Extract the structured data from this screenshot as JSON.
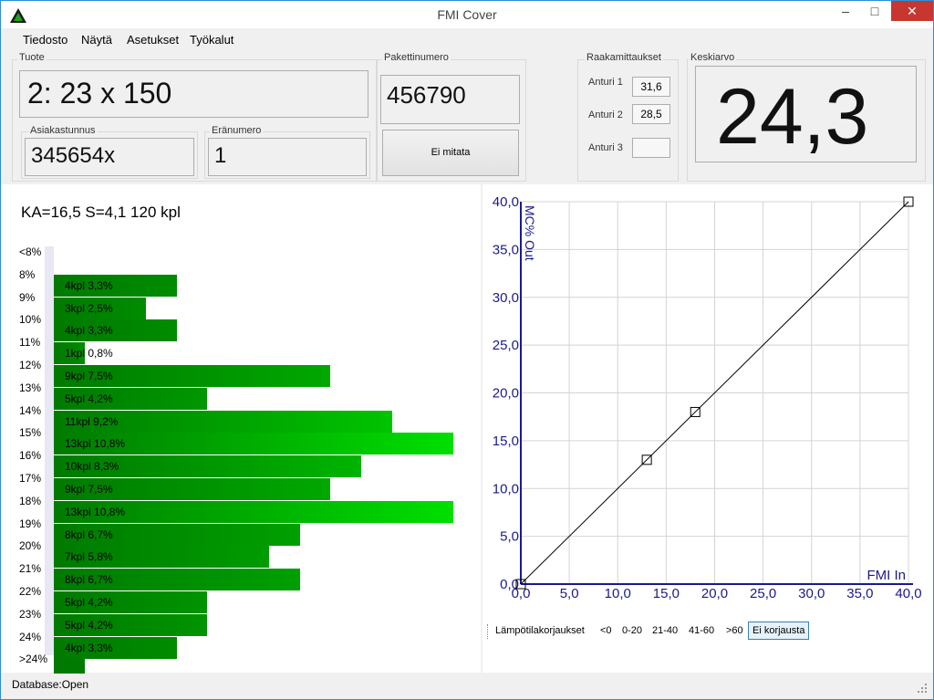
{
  "window": {
    "title": "FMI Cover",
    "minimize": "–",
    "maximize": "□",
    "close": "✕"
  },
  "menu": [
    "Tiedosto",
    "Näytä",
    "Asetukset",
    "Työkalut"
  ],
  "tuote": {
    "label": "Tuote",
    "value": "2: 23 x 150"
  },
  "asiakastunnus": {
    "label": "Asiakastunnus",
    "value": "345654x"
  },
  "eranumero": {
    "label": "Eränumero",
    "value": "1"
  },
  "pakettinumero": {
    "label": "Pakettinumero",
    "value": "456790"
  },
  "measure_button": "Ei mitata",
  "raakamittaukset": {
    "label": "Raakamittaukset",
    "sensors": [
      {
        "label": "Anturi 1",
        "value": "31,6"
      },
      {
        "label": "Anturi 2",
        "value": "28,5"
      },
      {
        "label": "Anturi 3",
        "value": ""
      }
    ]
  },
  "keskiarvo": {
    "label": "Keskiarvo",
    "value": "24,3"
  },
  "histogram": {
    "summary": "KA=16,5  S=4,1  120 kpl",
    "rows": [
      {
        "label": "<8%",
        "text": "",
        "count": 0,
        "color": "#007a00"
      },
      {
        "label": "8%",
        "text": "4kpl  3,3%",
        "count": 4,
        "color": "#008c00"
      },
      {
        "label": "9%",
        "text": "3kpl  2,5%",
        "count": 3,
        "color": "#008c00"
      },
      {
        "label": "10%",
        "text": "4kpl  3,3%",
        "count": 4,
        "color": "#008c00"
      },
      {
        "label": "11%",
        "text": "1kpl  0,8%",
        "count": 1,
        "color": "#008c00"
      },
      {
        "label": "12%",
        "text": "9kpl  7,5%",
        "count": 9,
        "color": "#00a800"
      },
      {
        "label": "13%",
        "text": "5kpl  4,2%",
        "count": 5,
        "color": "#009800"
      },
      {
        "label": "14%",
        "text": "11kpl  9,2%",
        "count": 11,
        "color": "#00c400"
      },
      {
        "label": "15%",
        "text": "13kpl  10,8%",
        "count": 13,
        "color": "#00e000"
      },
      {
        "label": "16%",
        "text": "10kpl  8,3%",
        "count": 10,
        "color": "#00b400"
      },
      {
        "label": "17%",
        "text": "9kpl  7,5%",
        "count": 9,
        "color": "#00a800"
      },
      {
        "label": "18%",
        "text": "13kpl  10,8%",
        "count": 13,
        "color": "#00e000"
      },
      {
        "label": "19%",
        "text": "8kpl  6,7%",
        "count": 8,
        "color": "#00a000"
      },
      {
        "label": "20%",
        "text": "7kpl  5,8%",
        "count": 7,
        "color": "#009c00"
      },
      {
        "label": "21%",
        "text": "8kpl  6,7%",
        "count": 8,
        "color": "#00a000"
      },
      {
        "label": "22%",
        "text": "5kpl  4,2%",
        "count": 5,
        "color": "#009400"
      },
      {
        "label": "23%",
        "text": "5kpl  4,2%",
        "count": 5,
        "color": "#009400"
      },
      {
        "label": "24%",
        "text": "4kpl  3,3%",
        "count": 4,
        "color": "#008c00"
      },
      {
        "label": ">24%",
        "text": "",
        "count": 1,
        "color": "#007a00"
      }
    ]
  },
  "chart_data": {
    "type": "scatter",
    "title": "",
    "xlabel": "FMI In",
    "ylabel": "MC% Out",
    "xlim": [
      0,
      40
    ],
    "ylim": [
      0,
      40
    ],
    "xticks": [
      "0,0",
      "5,0",
      "10,0",
      "15,0",
      "20,0",
      "25,0",
      "30,0",
      "35,0",
      "40,0"
    ],
    "yticks": [
      "0,0",
      "5,0",
      "10,0",
      "15,0",
      "20,0",
      "25,0",
      "30,0",
      "35,0",
      "40,0"
    ],
    "grid": true,
    "line": [
      [
        0,
        0
      ],
      [
        40,
        40
      ]
    ],
    "points": [
      [
        0,
        0
      ],
      [
        13,
        13
      ],
      [
        18,
        18
      ],
      [
        40,
        40
      ]
    ],
    "axis_color": "#1a1a8c"
  },
  "lampotila": {
    "label": "Lämpötilakorjaukset",
    "options": [
      "<0",
      "0-20",
      "21-40",
      "41-60",
      ">60",
      "Ei korjausta"
    ],
    "selected": "Ei korjausta"
  },
  "status": "Database:Open"
}
